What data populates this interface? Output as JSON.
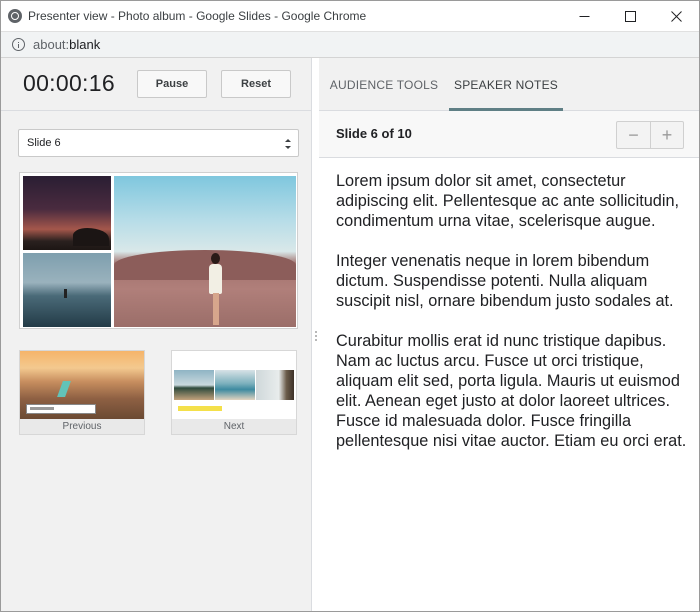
{
  "window": {
    "title": "Presenter view - Photo album - Google Slides - Google Chrome",
    "url_host": "about:",
    "url_path": "blank",
    "controls": [
      "minimize-icon",
      "maximize-icon",
      "close-icon"
    ]
  },
  "presenter": {
    "timer": "00:00:16",
    "pause_label": "Pause",
    "reset_label": "Reset",
    "slide_select_value": "Slide 6",
    "previous_label": "Previous",
    "next_label": "Next"
  },
  "tabs": {
    "audience_tools": "AUDIENCE TOOLS",
    "speaker_notes": "SPEAKER NOTES",
    "active": "speaker_notes"
  },
  "notes": {
    "slide_position": "Slide 6 of 10",
    "zoom_out": "−",
    "zoom_in": "+",
    "paragraphs": [
      "Lorem ipsum dolor sit amet, consectetur adipiscing elit. Pellentesque ac ante sollicitudin, condimentum urna vitae, scelerisque augue.",
      "Integer venenatis neque in lorem bibendum dictum. Suspendisse potenti. Nulla aliquam suscipit nisl, ornare bibendum justo sodales at.",
      "Curabitur mollis erat id nunc tristique dapibus. Nam ac luctus arcu. Fusce ut orci tristique, aliquam elit sed, porta ligula. Mauris ut euismod elit. Aenean eget justo at dolor laoreet ultrices. Fusce id malesuada dolor. Fusce fringilla pellentesque nisi vitae auctor. Etiam eu orci erat."
    ]
  },
  "colors": {
    "tab_indicator": "#5f7f85",
    "left_pane_bg": "#f1f1f1",
    "notes_bg": "#ffffff"
  }
}
